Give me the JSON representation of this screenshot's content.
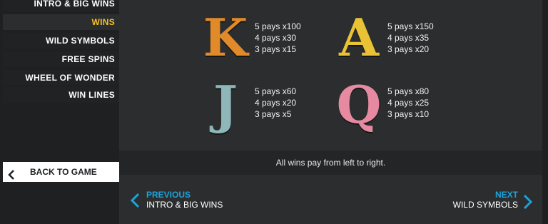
{
  "menu": {
    "items": [
      {
        "label": "INTRO & BIG WINS",
        "active": false
      },
      {
        "label": "WINS",
        "active": true
      },
      {
        "label": "WILD SYMBOLS",
        "active": false
      },
      {
        "label": "FREE SPINS",
        "active": false
      },
      {
        "label": "WHEEL OF WONDER",
        "active": false
      },
      {
        "label": "WIN LINES",
        "active": false
      }
    ],
    "back_label": "BACK TO GAME"
  },
  "symbols": [
    {
      "letter": "K",
      "pays": [
        "5 pays x100",
        "4 pays x30",
        "3 pays x15"
      ],
      "color": "#e08a2a"
    },
    {
      "letter": "A",
      "pays": [
        "5 pays x150",
        "4 pays x35",
        "3 pays x20"
      ],
      "color": "#e9c235"
    },
    {
      "letter": "J",
      "pays": [
        "5 pays x60",
        "4 pays x20",
        "3 pays x5"
      ],
      "color": "#8fb6b8"
    },
    {
      "letter": "Q",
      "pays": [
        "5 pays x80",
        "4 pays x25",
        "3 pays x10"
      ],
      "color": "#e58aa0"
    }
  ],
  "footer_note": "All wins pay from left to right.",
  "nav": {
    "prev_label": "PREVIOUS",
    "prev_target": "INTRO & BIG WINS",
    "next_label": "NEXT",
    "next_target": "WILD SYMBOLS"
  },
  "colors": {
    "accent_active": "#f4c324",
    "nav_accent": "#1ea3d8"
  }
}
